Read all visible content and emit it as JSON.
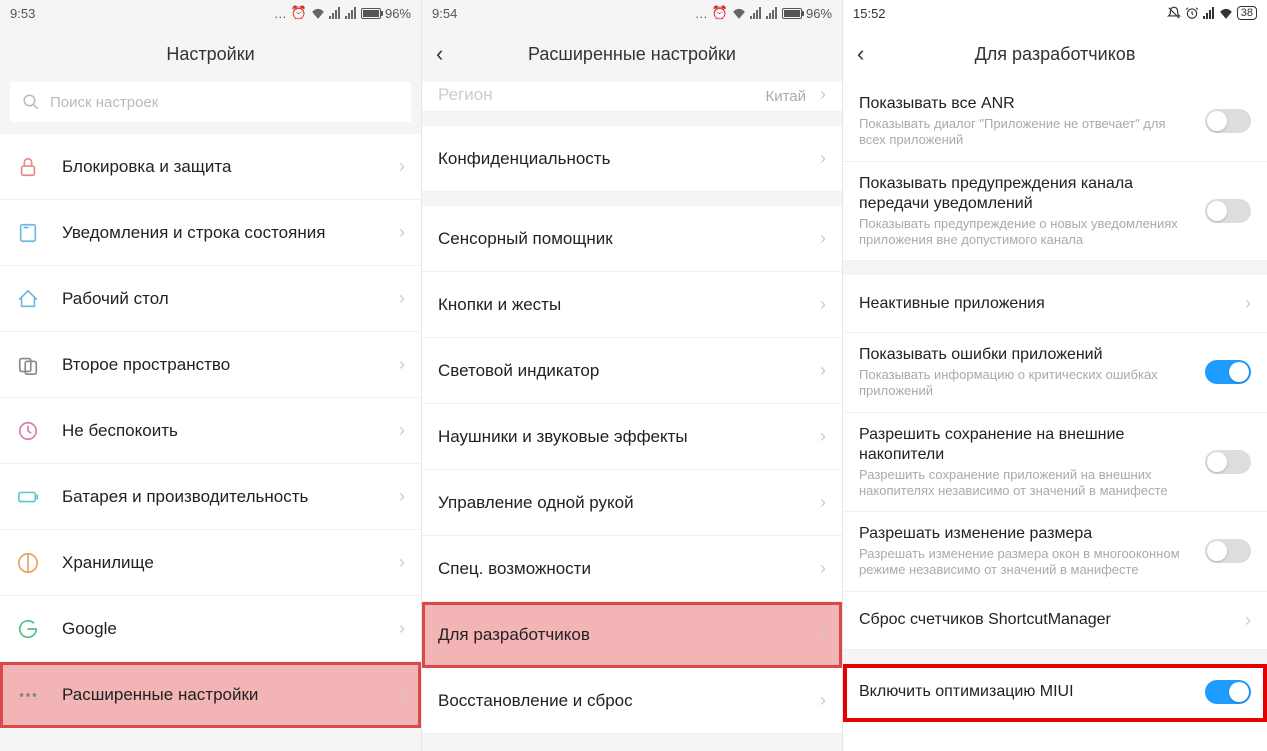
{
  "col1": {
    "status_time": "9:53",
    "status_batt": "96%",
    "title": "Настройки",
    "search_placeholder": "Поиск настроек",
    "rows": [
      {
        "label": "Блокировка и защита",
        "icon": "lock"
      },
      {
        "label": "Уведомления и строка состояния",
        "icon": "notifications"
      },
      {
        "label": "Рабочий стол",
        "icon": "home"
      },
      {
        "label": "Второе пространство",
        "icon": "second-space"
      },
      {
        "label": "Не беспокоить",
        "icon": "dnd"
      },
      {
        "label": "Батарея и производительность",
        "icon": "battery"
      },
      {
        "label": "Хранилище",
        "icon": "storage"
      },
      {
        "label": "Google",
        "icon": "google"
      },
      {
        "label": "Расширенные настройки",
        "icon": "more",
        "highlighted": true
      }
    ]
  },
  "col2": {
    "status_time": "9:54",
    "status_batt": "96%",
    "title": "Расширенные настройки",
    "rows_top": [
      {
        "label": "Регион",
        "value": "Китай"
      }
    ],
    "rows": [
      {
        "label": "Конфиденциальность"
      },
      {
        "label": "Сенсорный помощник"
      },
      {
        "label": "Кнопки и жесты"
      },
      {
        "label": "Световой индикатор"
      },
      {
        "label": "Наушники и звуковые эффекты"
      },
      {
        "label": "Управление одной рукой"
      },
      {
        "label": "Спец. возможности"
      },
      {
        "label": "Для разработчиков",
        "highlighted": true
      },
      {
        "label": "Восстановление и сброс"
      }
    ]
  },
  "col3": {
    "status_time": "15:52",
    "status_batt": "38",
    "title": "Для разработчиков",
    "rows": [
      {
        "title": "Показывать все ANR",
        "sub": "Показывать диалог \"Приложение не отвечает\" для всех приложений",
        "toggle": "off"
      },
      {
        "title": "Показывать предупреждения канала передачи уведомлений",
        "sub": "Показывать предупреждение о новых уведомлениях приложения вне допустимого канала",
        "toggle": "off"
      },
      {
        "title": "Неактивные приложения",
        "chev": true,
        "simple": true
      },
      {
        "title": "Показывать ошибки приложений",
        "sub": "Показывать информацию о критических ошибках приложений",
        "toggle": "on"
      },
      {
        "title": "Разрешить сохранение на внешние накопители",
        "sub": "Разрешить сохранение приложений на внешних накопителях независимо от значений в манифесте",
        "toggle": "off"
      },
      {
        "title": "Разрешать изменение размера",
        "sub": "Разрешать изменение размера окон в многооконном режиме независимо от значений в манифесте",
        "toggle": "off"
      },
      {
        "title": "Сброс счетчиков ShortcutManager",
        "chev": true,
        "simple": true
      },
      {
        "title": "Включить оптимизацию MIUI",
        "toggle": "on",
        "redbox": true,
        "simple": true
      }
    ]
  }
}
